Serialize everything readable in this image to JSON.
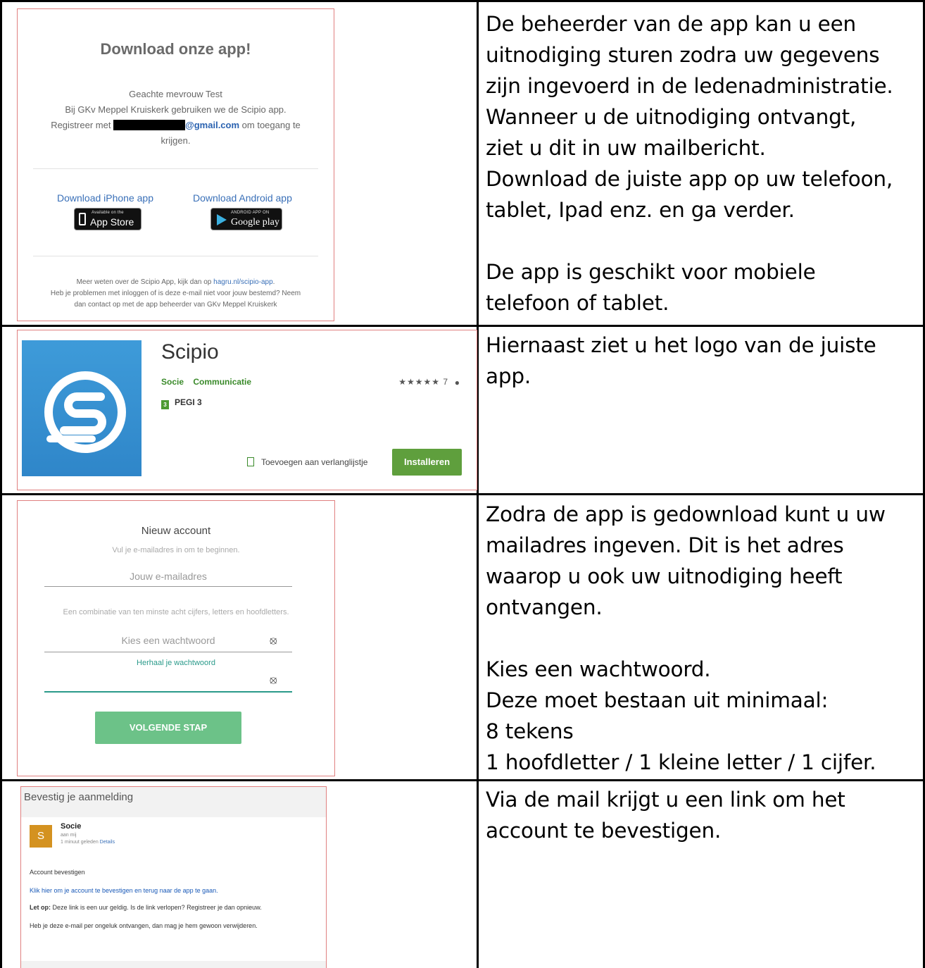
{
  "rows": [
    {
      "text": "De beheerder van de app kan u een\nuitnodiging sturen zodra uw gegevens\nzijn ingevoerd in de ledenadministratie.\nWanneer u de uitnodiging ontvangt,\nziet u dit in uw mailbericht.\nDownload de juiste app op uw telefoon,\ntablet, Ipad enz. en ga verder.\n\nDe app is geschikt voor mobiele\ntelefoon of tablet."
    },
    {
      "text": "Hiernaast ziet u het logo van de juiste\napp."
    },
    {
      "text": "Zodra de app is gedownload kunt u uw\nmailadres ingeven. Dit is het adres\nwaarop u ook uw uitnodiging heeft\nontvangen.\n\nKies een wachtwoord.\nDeze moet bestaan uit minimaal:\n8 tekens\n1 hoofdletter / 1 kleine letter / 1 cijfer."
    },
    {
      "text": "Via de mail krijgt u een link om het\naccount te bevestigen."
    }
  ],
  "invite_email": {
    "title": "Download onze app!",
    "greeting": "Geachte mevrouw Test",
    "line1": "Bij GKv Meppel Kruiskerk gebruiken we de Scipio app.",
    "register_prefix": "Registreer met",
    "email_suffix": "@gmail.com",
    "register_suffix": "om toegang te",
    "register_end": "krijgen.",
    "iphone_link": "Download iPhone app",
    "android_link": "Download Android app",
    "appstore_small": "Available on the",
    "appstore_big": "App Store",
    "googleplay_small": "ANDROID APP ON",
    "googleplay_big": "Google play",
    "footer1_prefix": "Meer weten over de Scipio App, kijk dan op",
    "footer1_link": "hagru.nl/scipio-app",
    "footer1_suffix": ".",
    "footer2": "Heb je problemen met inloggen of is deze e-mail niet voor jouw bestemd? Neem",
    "footer3": "dan contact op met de app beheerder van GKv Meppel Kruiskerk"
  },
  "store_listing": {
    "app_name": "Scipio",
    "developer": "Socie",
    "category": "Communicatie",
    "rating_text": "★★★★★ 7",
    "rating": 4.5,
    "pegi": "PEGI 3",
    "pegi_badge": "3",
    "wishlist": "Toevoegen aan verlanglijstje",
    "install": "Installeren",
    "colors": {
      "green": "#5f9f3d",
      "logo_blue": "#3e9bd9"
    }
  },
  "new_account": {
    "title": "Nieuw account",
    "subtitle": "Vul je e-mailadres in om te beginnen.",
    "email_placeholder": "Jouw e-mailadres",
    "hint": "Een combinatie van ten minste acht cijfers, letters en hoofdletters.",
    "password_placeholder": "Kies een wachtwoord",
    "repeat_label": "Herhaal je wachtwoord",
    "next_button": "VOLGENDE STAP"
  },
  "confirm_email": {
    "subject": "Bevestig je aanmelding",
    "avatar_letter": "S",
    "sender": "Socie",
    "to": "aan mij",
    "time": "1 minuut geleden",
    "details": "Details",
    "heading": "Account bevestigen",
    "link": "Klik hier om je account te bevestigen en terug naar de app te gaan.",
    "note_bold": "Let op:",
    "note": "Deze link is een uur geldig. Is de link verlopen? Registreer je dan opnieuw.",
    "ignore": "Heb je deze e-mail per ongeluk ontvangen, dan mag je hem gewoon verwijderen."
  }
}
